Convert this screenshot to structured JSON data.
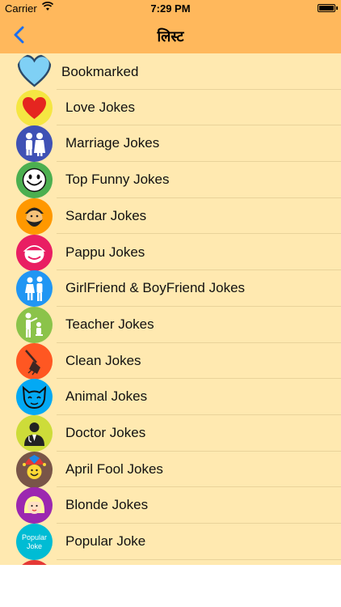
{
  "status_bar": {
    "carrier": "Carrier",
    "time": "7:29 PM"
  },
  "nav": {
    "title": "लिस्ट"
  },
  "list": {
    "items": [
      {
        "label": "Bookmarked",
        "icon": "heart-outline-icon"
      },
      {
        "label": "Love Jokes",
        "icon": "heart-icon",
        "color": "#f5e642"
      },
      {
        "label": "Marriage Jokes",
        "icon": "couple-icon",
        "color": "#3f51b5"
      },
      {
        "label": "Top  Funny Jokes",
        "icon": "smiley-icon",
        "color": "#4caf50"
      },
      {
        "label": "Sardar Jokes",
        "icon": "sardar-icon",
        "color": "#ff9800"
      },
      {
        "label": "Pappu Jokes",
        "icon": "pappu-icon",
        "color": "#e91e63"
      },
      {
        "label": "GirlFriend & BoyFriend Jokes",
        "icon": "lovers-icon",
        "color": "#2196f3"
      },
      {
        "label": "Teacher Jokes",
        "icon": "teacher-icon",
        "color": "#8bc34a"
      },
      {
        "label": "Clean Jokes",
        "icon": "broom-icon",
        "color": "#ff5722"
      },
      {
        "label": "Animal Jokes",
        "icon": "cat-icon",
        "color": "#03a9f4"
      },
      {
        "label": "Doctor Jokes",
        "icon": "doctor-icon",
        "color": "#cddc39"
      },
      {
        "label": "April Fool Jokes",
        "icon": "jester-icon",
        "color": "#795548"
      },
      {
        "label": "Blonde Jokes",
        "icon": "blonde-icon",
        "color": "#9c27b0"
      },
      {
        "label": "Popular Joke",
        "icon": "popular-joke-icon",
        "color": "#00bcd4",
        "icon_text": "Popular Joke"
      }
    ]
  }
}
